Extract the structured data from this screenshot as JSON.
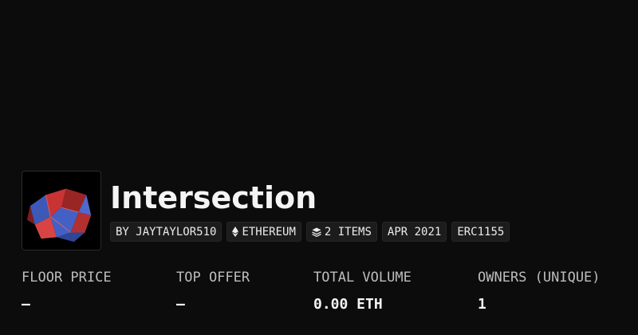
{
  "collection": {
    "title": "Intersection",
    "avatar_icon": "polyhedron-artwork",
    "chips": [
      {
        "label": "BY JAYTAYLOR510",
        "icon": null
      },
      {
        "label": "ETHEREUM",
        "icon": "ethereum-icon"
      },
      {
        "label": "2 ITEMS",
        "icon": "layers-icon"
      },
      {
        "label": "APR 2021",
        "icon": null
      },
      {
        "label": "ERC1155",
        "icon": null
      }
    ]
  },
  "stats": [
    {
      "label": "FLOOR PRICE",
      "value": "—"
    },
    {
      "label": "TOP OFFER",
      "value": "—"
    },
    {
      "label": "TOTAL VOLUME",
      "value": "0.00 ETH"
    },
    {
      "label": "OWNERS (UNIQUE)",
      "value": "1"
    }
  ],
  "colors": {
    "background": "#0c0c0c",
    "chip_background": "#1c1c1c",
    "text": "#f2f2f2",
    "muted_text": "#bdbdbd",
    "art_red": "#d63a3a",
    "art_blue": "#4a63c8"
  }
}
